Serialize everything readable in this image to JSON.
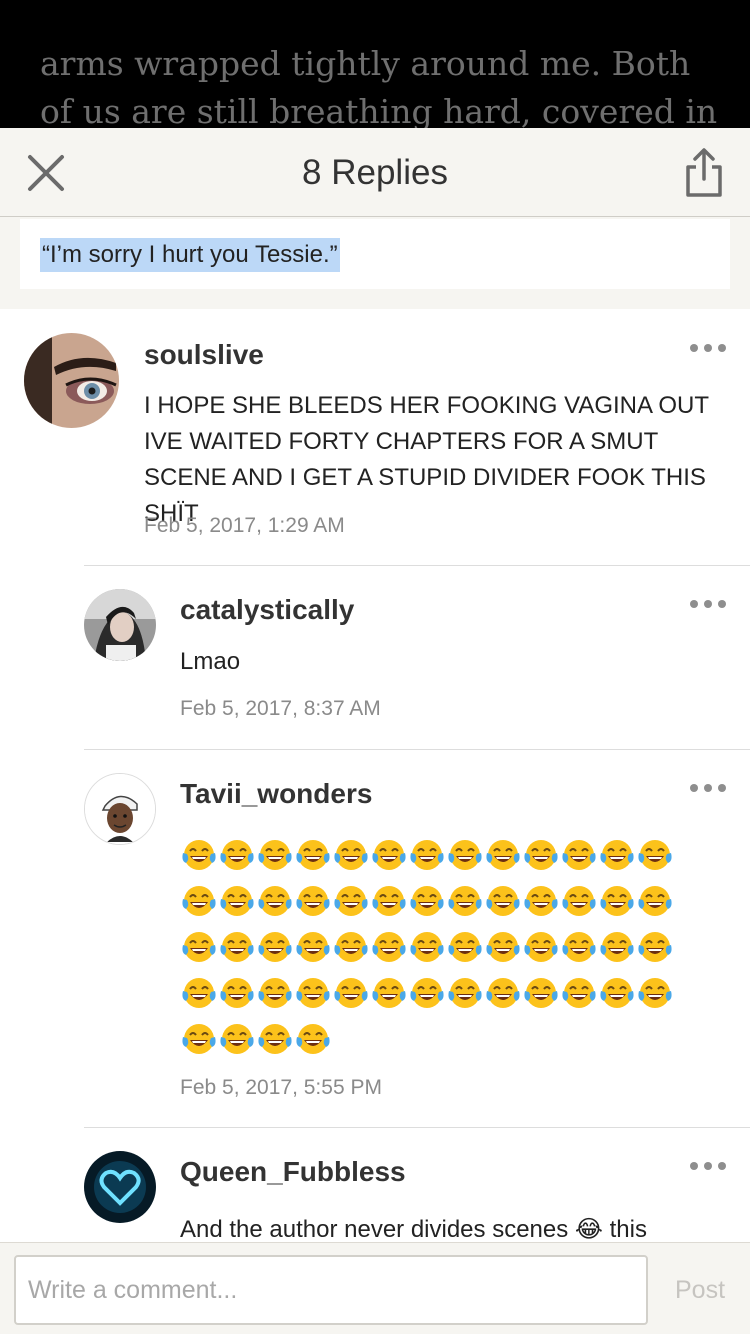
{
  "reader_background": {
    "text": "arms wrapped tightly around me. Both of us are still breathing hard, covered in a sheen of"
  },
  "header": {
    "title": "8 Replies",
    "close_icon": "close-icon",
    "share_icon": "share-icon"
  },
  "quote": {
    "text": "“I’m sorry I hurt you Tessie.”"
  },
  "comments": [
    {
      "username": "soulslive",
      "text": "I HOPE SHE BLEEDS HER FOOKING VAGINA OUT IVE WAITED FORTY CHAPTERS FOR A SMUT SCENE AND I GET A STUPID DIVIDER FOOK THIS SHÏT",
      "date": "Feb 5, 2017, 1:29 AM"
    },
    {
      "username": "catalystically",
      "text": "Lmao",
      "date": "Feb 5, 2017, 8:37 AM"
    },
    {
      "username": "Tavii_wonders",
      "emoji": "face-with-tears-of-joy",
      "emoji_count": 56,
      "date": "Feb 5, 2017, 5:55 PM"
    },
    {
      "username": "Queen_Fubbless",
      "text": "And the author never divides scenes 😂 this"
    }
  ],
  "footer": {
    "input_placeholder": "Write a comment...",
    "post_label": "Post"
  },
  "colors": {
    "header_bg": "#f6f5f1",
    "highlight": "#bcd8f7",
    "date_text": "#8a8a8a",
    "post_disabled": "#c6c4c0"
  }
}
